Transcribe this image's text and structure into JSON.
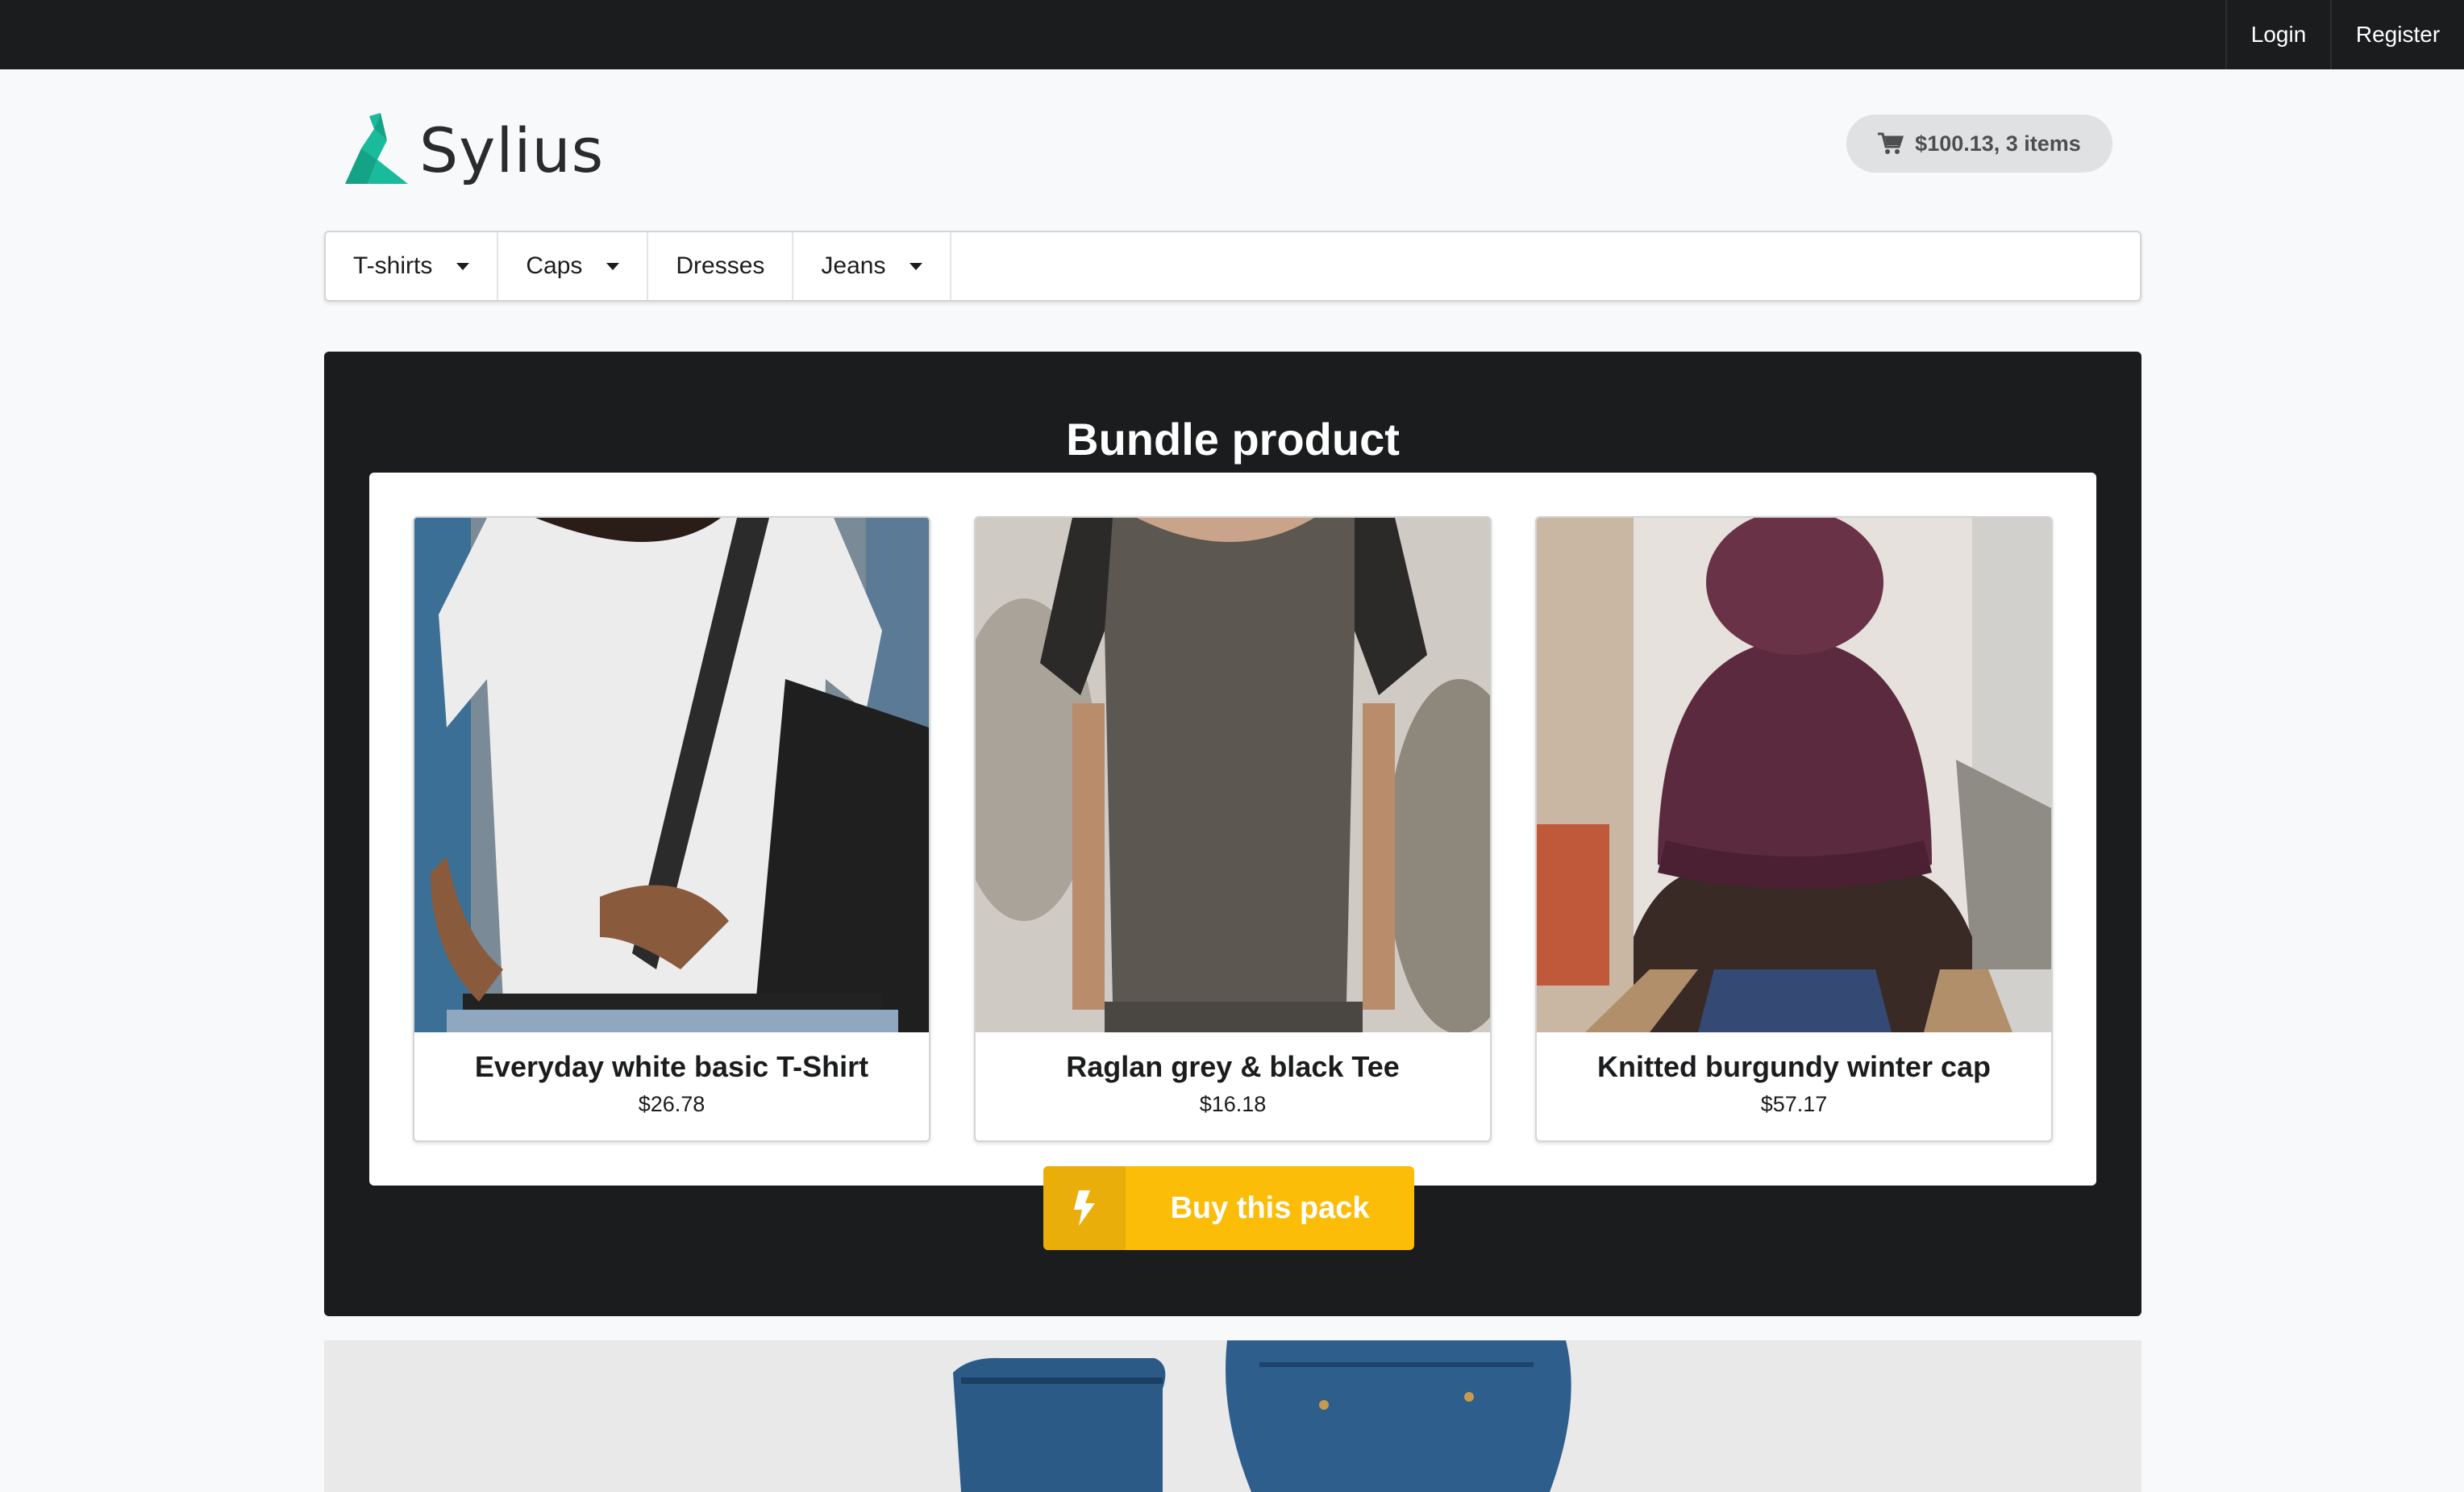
{
  "topbar": {
    "login_label": "Login",
    "register_label": "Register"
  },
  "header": {
    "logo_text": "Sylius",
    "cart_label": "$100.13, 3 items"
  },
  "menu": {
    "items": [
      {
        "label": "T-shirts",
        "dropdown": true
      },
      {
        "label": "Caps",
        "dropdown": true
      },
      {
        "label": "Dresses",
        "dropdown": false
      },
      {
        "label": "Jeans",
        "dropdown": true
      }
    ]
  },
  "bundle": {
    "title": "Bundle product",
    "products": [
      {
        "name": "Everyday white basic T-Shirt",
        "price": "$26.78"
      },
      {
        "name": "Raglan grey & black Tee",
        "price": "$16.18"
      },
      {
        "name": "Knitted burgundy winter cap",
        "price": "$57.17"
      }
    ],
    "buy_label": "Buy this pack",
    "buy_icon": "lightning-icon"
  },
  "colors": {
    "topbar": "#1b1c1d",
    "accent": "#fbbd08",
    "brand": "#1abb9c"
  }
}
